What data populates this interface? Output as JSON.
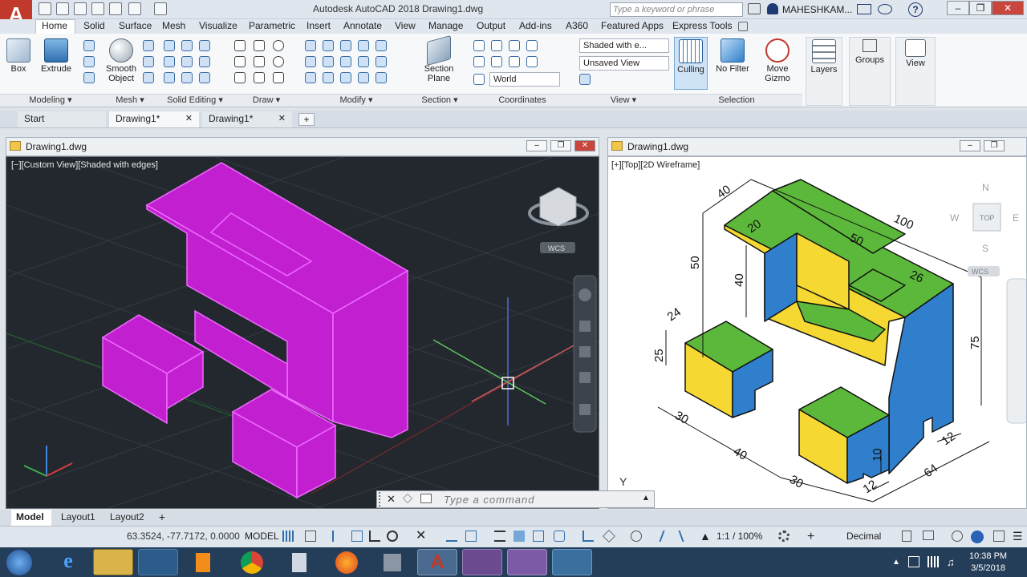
{
  "app": {
    "title": "Autodesk AutoCAD 2018  Drawing1.dwg",
    "search_placeholder": "Type a keyword or phrase",
    "user": "MAHESHKAM...",
    "logo_letter": "A"
  },
  "ribbon_tabs": [
    "Home",
    "Solid",
    "Surface",
    "Mesh",
    "Visualize",
    "Parametric",
    "Insert",
    "Annotate",
    "View",
    "Manage",
    "Output",
    "Add-ins",
    "A360",
    "Featured Apps",
    "Express Tools"
  ],
  "ribbon": {
    "box": "Box",
    "extrude": "Extrude",
    "smooth_object_1": "Smooth",
    "smooth_object_2": "Object",
    "section_plane_1": "Section",
    "section_plane_2": "Plane",
    "visual_style": "Shaded with e...",
    "saved_view": "Unsaved View",
    "ucs": "World",
    "culling": "Culling",
    "no_filter": "No Filter",
    "move_gizmo_1": "Move",
    "move_gizmo_2": "Gizmo",
    "layers": "Layers",
    "groups": "Groups",
    "view": "View",
    "panels": [
      "Modeling",
      "Mesh",
      "Solid Editing",
      "Draw",
      "Modify",
      "Section",
      "Coordinates",
      "View",
      "Selection"
    ]
  },
  "doc_tabs": [
    "Start",
    "Drawing1*",
    "Drawing1*"
  ],
  "viewports": {
    "left_title": "Drawing1.dwg",
    "left_label": "[−][Custom View][Shaded with edges]",
    "right_title": "Drawing1.dwg",
    "right_label": "[+][Top][2D Wireframe]",
    "wcs": "WCS",
    "compass": {
      "n": "N",
      "s": "S",
      "w": "W",
      "e": "E",
      "top": "TOP"
    }
  },
  "dimensions": {
    "d40a": "40",
    "d100": "100",
    "d20": "20",
    "d50a": "50",
    "d50b": "50",
    "d40b": "40",
    "d26": "26",
    "d24": "24",
    "d25": "25",
    "d75": "75",
    "d30a": "30",
    "d40c": "40",
    "d30b": "30",
    "d10": "10",
    "d12a": "12",
    "d12b": "12",
    "d64": "64"
  },
  "command": {
    "placeholder": "Type a command"
  },
  "layout_tabs": [
    "Model",
    "Layout1",
    "Layout2"
  ],
  "status": {
    "coords": "63.3524, -77.7172, 0.0000",
    "mode": "MODEL",
    "scale": "1:1 / 100%",
    "units": "Decimal"
  },
  "clock": {
    "time": "10:38 PM",
    "date": "3/5/2018"
  },
  "colors": {
    "magenta": "#c21fd1",
    "green": "#5cb83a",
    "yellow": "#f5d832",
    "blue": "#2f7fcc",
    "viewport_bg": "#23282f"
  }
}
